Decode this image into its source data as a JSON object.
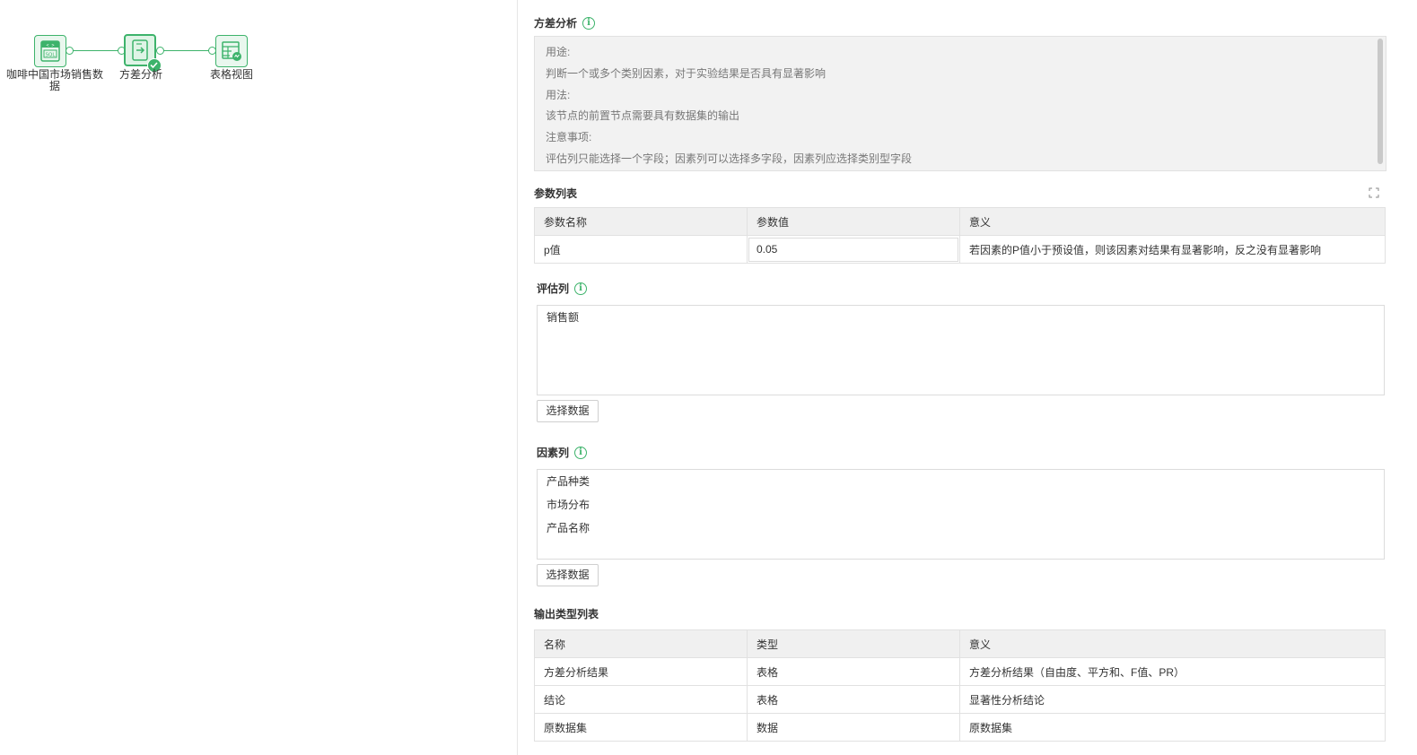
{
  "canvas": {
    "nodes": [
      {
        "label": "咖啡中国市场销售数据",
        "icon": "sql-database-icon"
      },
      {
        "label": "方差分析",
        "icon": "analysis-node-icon",
        "status": "check-success-icon"
      },
      {
        "label": "表格视图",
        "icon": "table-view-icon"
      }
    ]
  },
  "panel": {
    "title": "方差分析",
    "description": [
      "用途:",
      "判断一个或多个类别因素，对于实验结果是否具有显著影响",
      "用法:",
      "该节点的前置节点需要具有数据集的输出",
      "注意事项:",
      "评估列只能选择一个字段；因素列可以选择多字段，因素列应选择类别型字段"
    ],
    "params": {
      "title": "参数列表",
      "headers": [
        "参数名称",
        "参数值",
        "意义"
      ],
      "rows": [
        {
          "name": "p值",
          "value": "0.05",
          "meaning": "若因素的P值小于预设值，则该因素对结果有显著影响，反之没有显著影响"
        }
      ]
    },
    "eval_col": {
      "title": "评估列",
      "items": [
        "销售额"
      ],
      "button": "选择数据"
    },
    "factor_col": {
      "title": "因素列",
      "items": [
        "产品种类",
        "市场分布",
        "产品名称"
      ],
      "button": "选择数据"
    },
    "output": {
      "title": "输出类型列表",
      "headers": [
        "名称",
        "类型",
        "意义"
      ],
      "rows": [
        [
          "方差分析结果",
          "表格",
          "方差分析结果（自由度、平方和、F值、PR）"
        ],
        [
          "结论",
          "表格",
          "显著性分析结论"
        ],
        [
          "原数据集",
          "数据",
          "原数据集"
        ]
      ]
    }
  },
  "colors": {
    "accent": "#3db36b",
    "header_bg": "#f0f0f0",
    "desc_bg": "#f2f2f2"
  }
}
